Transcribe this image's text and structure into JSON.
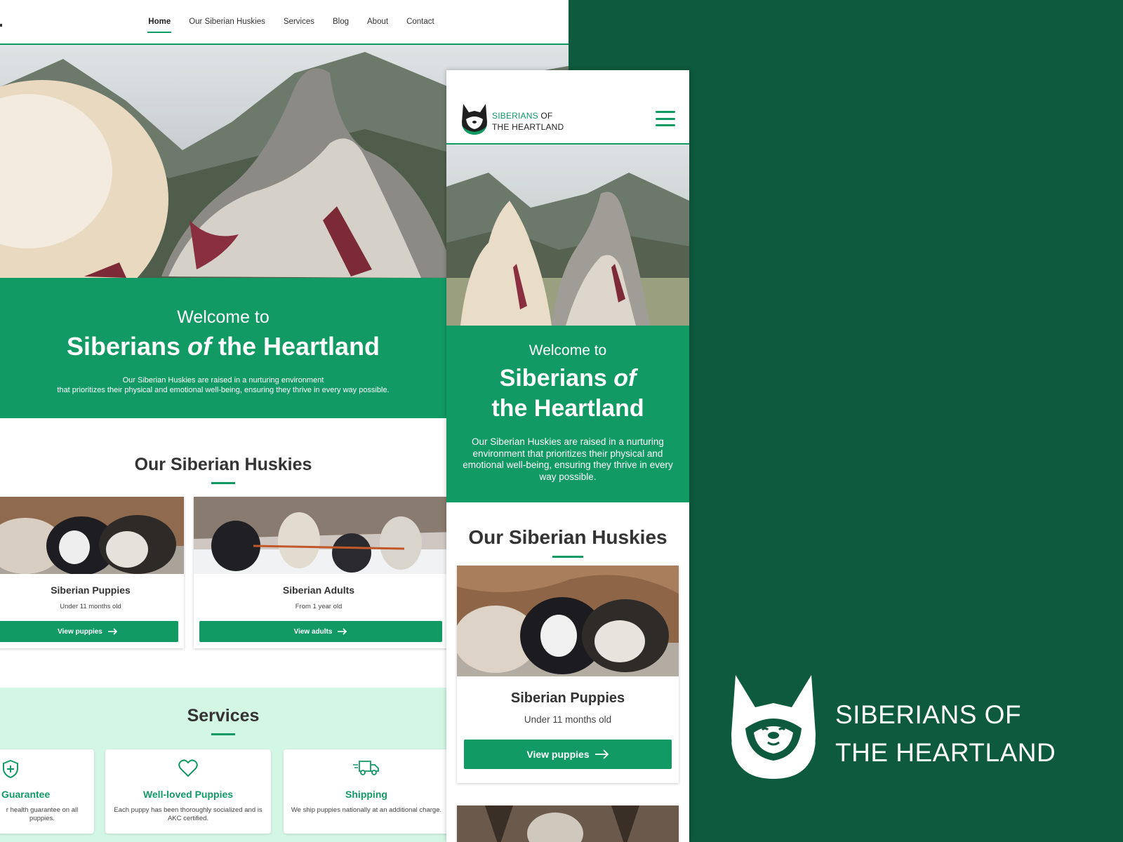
{
  "desktop": {
    "nav": [
      "Home",
      "Our Siberian Huskies",
      "Services",
      "Blog",
      "About",
      "Contact"
    ],
    "welcome": {
      "line1": "Welcome to",
      "title_a": "Siberians ",
      "title_of": "of",
      "title_b": " the Heartland",
      "desc1": "Our Siberian Huskies are raised in a nurturing environment",
      "desc2": "that prioritizes their physical and emotional well-being, ensuring they thrive in every way possible."
    },
    "huskies": {
      "title": "Our Siberian Huskies",
      "cards": [
        {
          "title": "Siberian Puppies",
          "sub": "Under 11 months old",
          "button": "View puppies"
        },
        {
          "title": "Siberian Adults",
          "sub": "From 1 year old",
          "button": "View adults"
        }
      ]
    },
    "services": {
      "title": "Services",
      "items": [
        {
          "title": "Guarantee",
          "desc": "r health guarantee on all puppies.",
          "icon": "shield-plus-icon"
        },
        {
          "title": "Well-loved Puppies",
          "desc": "Each puppy has been thoroughly socialized and is AKC certified.",
          "icon": "heart-icon"
        },
        {
          "title": "Shipping",
          "desc": "We ship puppies nationally at an additional charge.",
          "icon": "truck-icon"
        }
      ]
    }
  },
  "mobile": {
    "brand_line1": "SIBERIANS OF",
    "brand_line2": "THE HEARTLAND",
    "brand_accent": "SIBERIANS",
    "welcome": {
      "line1": "Welcome to",
      "title_a": "Siberians ",
      "title_of": "of",
      "title_b": "the Heartland",
      "desc": "Our Siberian Huskies are raised in a nurturing environment that prioritizes their physical and emotional well-being, ensuring they thrive in every way possible."
    },
    "huskies": {
      "title": "Our Siberian Huskies",
      "card": {
        "title": "Siberian Puppies",
        "sub": "Under 11 months old",
        "button": "View puppies"
      }
    }
  },
  "brand_lockup": {
    "line1": "SIBERIANS OF",
    "line2": "THE HEARTLAND"
  },
  "colors": {
    "primary": "#119a64",
    "dark_bg": "#0e5a3e",
    "mint": "#d4f6e5"
  }
}
